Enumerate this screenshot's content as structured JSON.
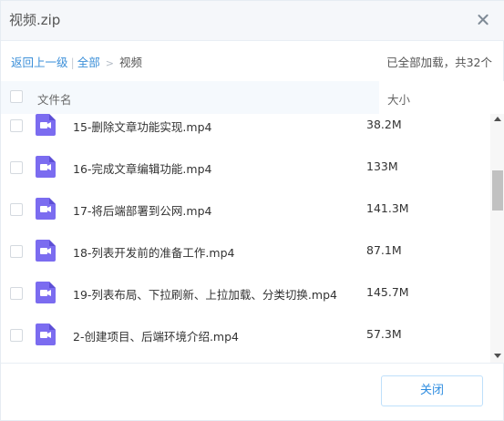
{
  "dialog": {
    "title": "视频.zip"
  },
  "breadcrumb": {
    "back_label": "返回上一级",
    "separator": "|",
    "all_label": "全部",
    "arrow": ">",
    "current_label": "视频"
  },
  "status": {
    "loaded_text": "已全部加载，共32个"
  },
  "table": {
    "col_name": "文件名",
    "col_size": "大小",
    "rows": [
      {
        "name": "15-删除文章功能实现.mp4",
        "size": "38.2M"
      },
      {
        "name": "16-完成文章编辑功能.mp4",
        "size": "133M"
      },
      {
        "name": "17-将后端部署到公网.mp4",
        "size": "141.3M"
      },
      {
        "name": "18-列表开发前的准备工作.mp4",
        "size": "87.1M"
      },
      {
        "name": "19-列表布局、下拉刷新、上拉加载、分类切换.mp4",
        "size": "145.7M"
      },
      {
        "name": "2-创建项目、后端环境介绍.mp4",
        "size": "57.3M"
      }
    ]
  },
  "footer": {
    "close_label": "关闭"
  },
  "colors": {
    "link": "#3b8fd9",
    "video_icon": "#7b6cf0",
    "header_bg": "#f5f9fd",
    "button_border": "#bfe0fb"
  },
  "icons": {
    "close": "close-icon",
    "file": "video-file-icon"
  }
}
